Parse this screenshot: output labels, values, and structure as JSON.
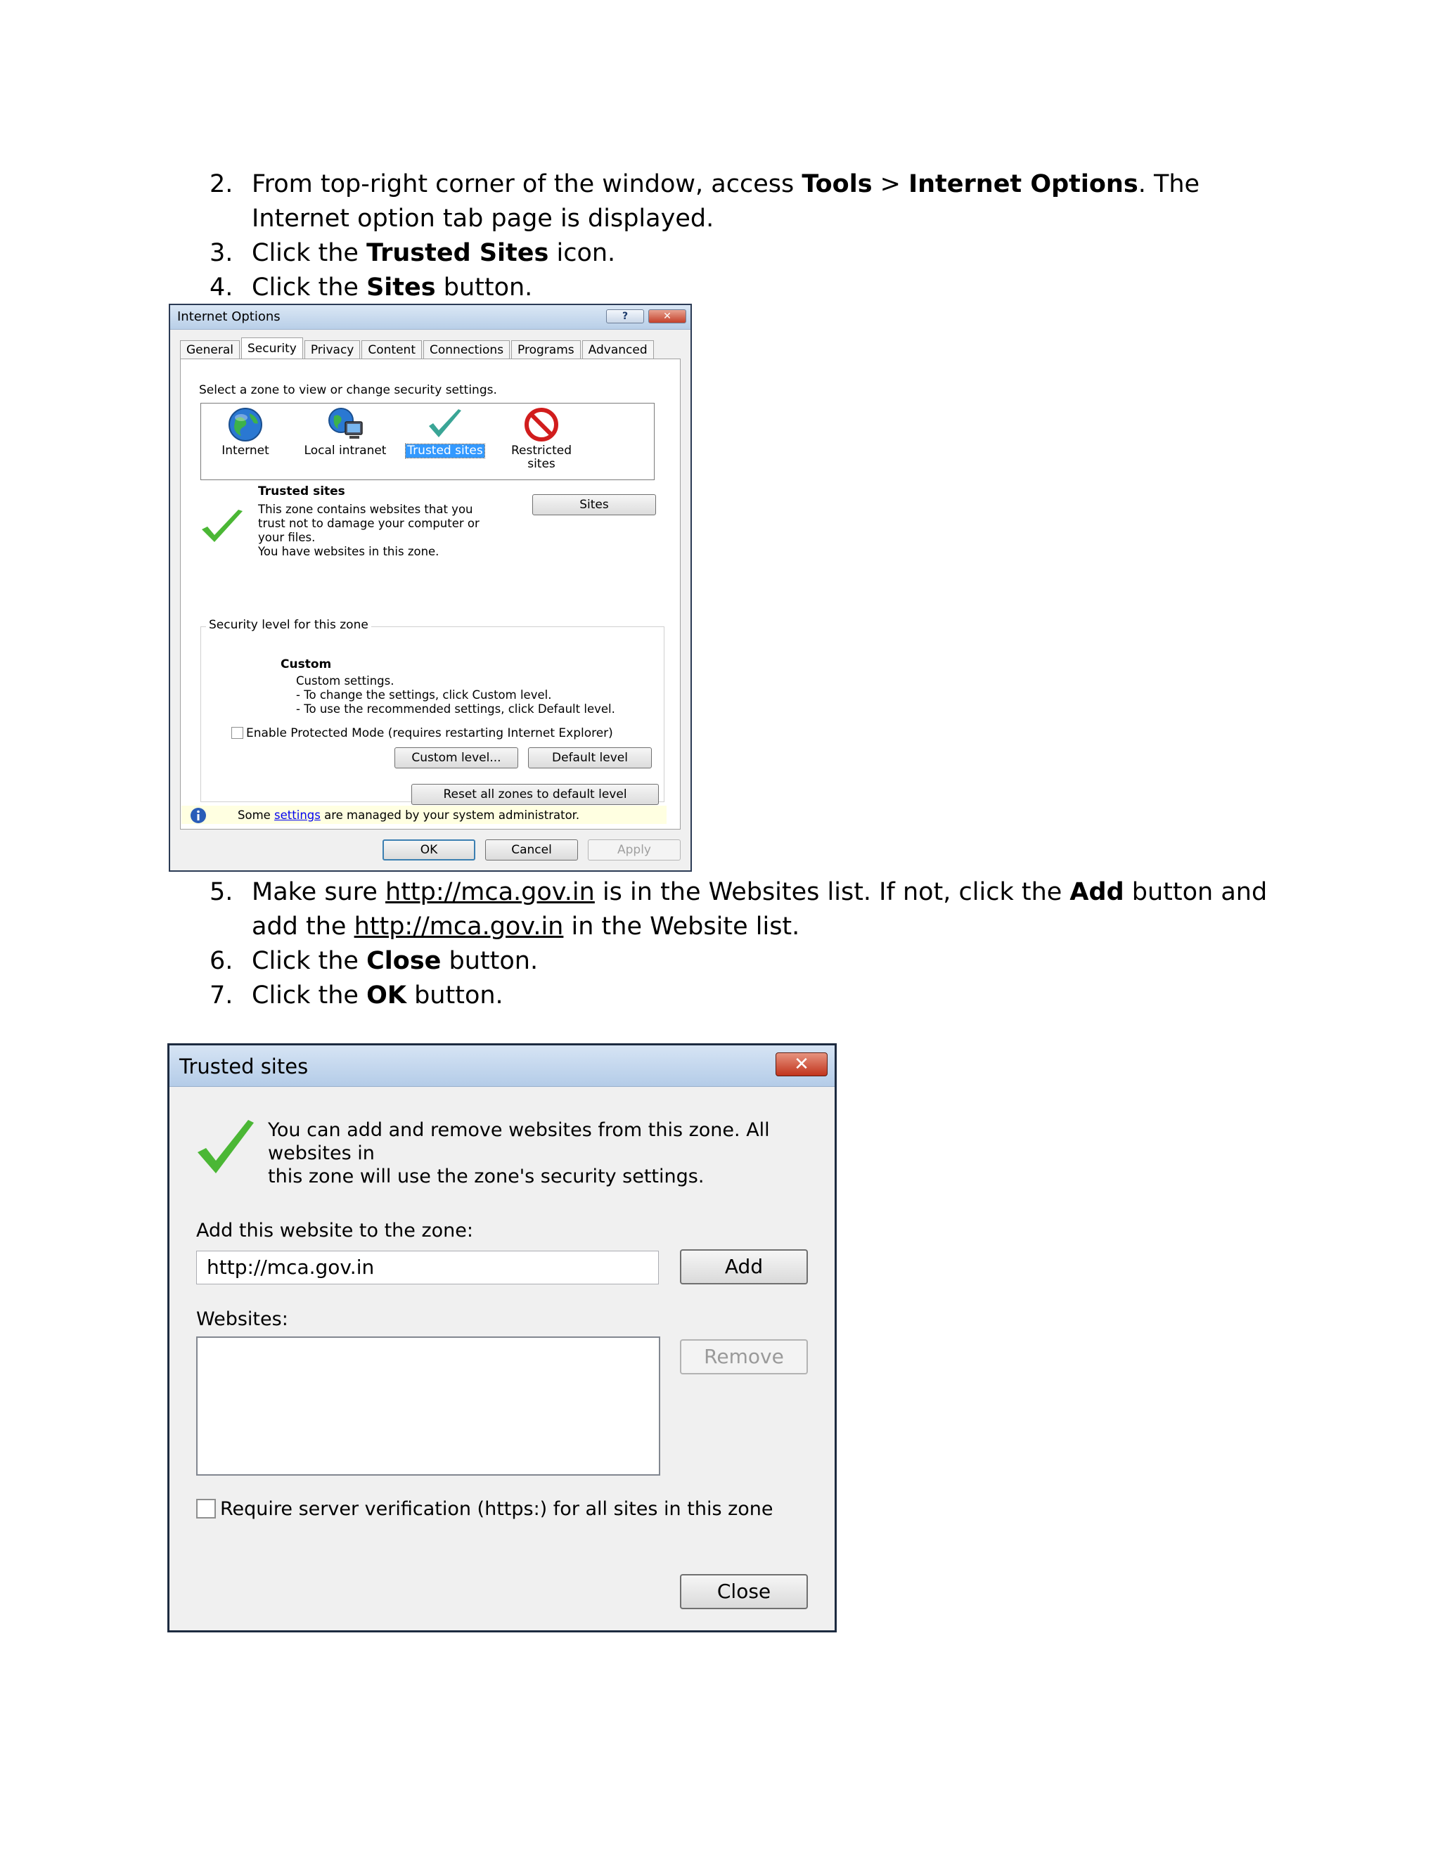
{
  "steps_top": [
    {
      "num": "2.",
      "pre": "From top-right corner of the window, access ",
      "b1": "Tools",
      "mid": " > ",
      "b2": "Internet Options",
      "post": ". The Internet option tab page is displayed."
    },
    {
      "num": "3.",
      "pre": "Click the ",
      "b1": "Trusted Sites",
      "post": " icon."
    },
    {
      "num": "4.",
      "pre": "Click the ",
      "b1": "Sites",
      "post": " button."
    }
  ],
  "steps_bottom": [
    {
      "num": "5.",
      "pre": "Make sure ",
      "link1": "http://mca.gov.in",
      "mid": " is in the Websites list. If not, click the ",
      "b1": "Add",
      "mid2": " button and add the ",
      "link2": "http://mca.gov.in",
      "post": " in the Website list."
    },
    {
      "num": "6.",
      "pre": "Click the ",
      "b1": "Close",
      "post": " button."
    },
    {
      "num": "7.",
      "pre": "Click the ",
      "b1": "OK",
      "post": " button."
    }
  ],
  "internet_options": {
    "title": "Internet Options",
    "help_glyph": "?",
    "close_glyph": "✕",
    "tabs": [
      "General",
      "Security",
      "Privacy",
      "Content",
      "Connections",
      "Programs",
      "Advanced"
    ],
    "active_tab": "Security",
    "zone_prompt": "Select a zone to view or change security settings.",
    "zones": [
      {
        "label": "Internet",
        "icon": "globe-icon"
      },
      {
        "label": "Local intranet",
        "icon": "intranet-icon"
      },
      {
        "label": "Trusted sites",
        "icon": "checkmark-icon",
        "selected": true
      },
      {
        "label": "Restricted",
        "label2": "sites",
        "icon": "no-entry-icon"
      }
    ],
    "zone_title": "Trusted sites",
    "zone_desc": [
      "This zone contains websites that you",
      "trust not to damage your computer or",
      "your files.",
      "You have websites in this zone."
    ],
    "sites_button": "Sites",
    "security_level_label": "Security level for this zone",
    "level_title": "Custom",
    "level_lines": [
      "Custom settings.",
      "- To change the settings, click Custom level.",
      "- To use the recommended settings, click Default level."
    ],
    "protected_mode": "Enable Protected Mode (requires restarting Internet Explorer)",
    "custom_level_button": "Custom level...",
    "default_level_button": "Default level",
    "reset_button": "Reset all zones to default level",
    "info_pre": "Some ",
    "info_link": "settings",
    "info_post": " are managed by your system administrator.",
    "ok_button": "OK",
    "cancel_button": "Cancel",
    "apply_button": "Apply"
  },
  "trusted_sites": {
    "title": "Trusted sites",
    "close_glyph": "✕",
    "description_line1": "You can add and remove websites from this zone. All websites in",
    "description_line2": "this zone will use the zone's security settings.",
    "add_label": "Add this website to the zone:",
    "url_value": "http://mca.gov.in",
    "add_button": "Add",
    "websites_label": "Websites:",
    "remove_button": "Remove",
    "require_https": "Require server verification (https:) for all sites in this zone",
    "close_button": "Close"
  }
}
